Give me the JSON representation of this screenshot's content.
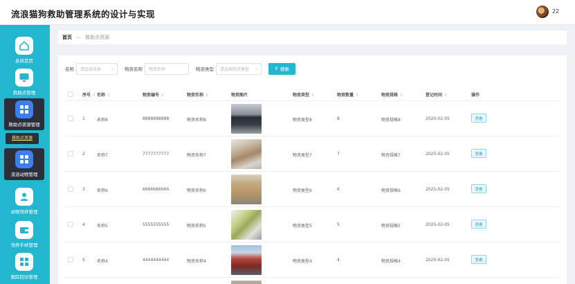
{
  "app": {
    "title": "流浪猫狗救助管理系统的设计与实现"
  },
  "user": {
    "name": "22"
  },
  "sidebar": {
    "items": [
      {
        "label": "系统首页",
        "icon": "home-icon"
      },
      {
        "label": "救助点管理",
        "icon": "monitor-icon"
      },
      {
        "label": "救助点资源管理",
        "icon": "grid-icon",
        "active": true
      },
      {
        "label": "流浪动物管理",
        "icon": "grid-icon",
        "active": true
      },
      {
        "label": "动物领养管理",
        "icon": "person-icon"
      },
      {
        "label": "领养手续管理",
        "icon": "wallet-icon"
      },
      {
        "label": "跟踪回访管理",
        "icon": "grid-icon"
      }
    ],
    "sub_item": "救助点资源"
  },
  "breadcrumb": {
    "home": "首页",
    "separator": "—",
    "current": "救助点资源"
  },
  "search": {
    "name_label": "名称",
    "name_placeholder": "请选择名称",
    "material_name_label": "物资名称",
    "material_name_placeholder": "物资名称",
    "material_type_label": "物资类型",
    "material_type_placeholder": "请选择物资类型",
    "button_label": "搜索"
  },
  "table": {
    "columns": [
      "序号",
      "名称",
      "物资编号",
      "物资名称",
      "物资图片",
      "物资类型",
      "物资数量",
      "物资规格",
      "登记时间",
      "操作"
    ],
    "rows": [
      {
        "index": "1",
        "name": "名称8",
        "code": "8888888888",
        "material": "物资名称8",
        "type": "物资类型8",
        "qty": "8",
        "spec": "物资规格8",
        "date": "2025-02-05",
        "action": "查看"
      },
      {
        "index": "2",
        "name": "名称7",
        "code": "7777777777",
        "material": "物资名称7",
        "type": "物资类型7",
        "qty": "7",
        "spec": "物资规格7",
        "date": "2025-02-05",
        "action": "查看"
      },
      {
        "index": "3",
        "name": "名称6",
        "code": "6666666666",
        "material": "物资名称6",
        "type": "物资类型6",
        "qty": "6",
        "spec": "物资规格6",
        "date": "2025-02-05",
        "action": "查看"
      },
      {
        "index": "4",
        "name": "名称5",
        "code": "5555555555",
        "material": "物资名称5",
        "type": "物资类型5",
        "qty": "5",
        "spec": "物资规格5",
        "date": "2025-02-05",
        "action": "查看"
      },
      {
        "index": "5",
        "name": "名称4",
        "code": "4444444444",
        "material": "物资名称4",
        "type": "物资类型4",
        "qty": "4",
        "spec": "物资规格4",
        "date": "2025-02-05",
        "action": "查看"
      }
    ]
  },
  "colors": {
    "accent": "#23b6cf",
    "sidebar_active": "#2c2f3a",
    "icon_active": "#3b7ff5"
  }
}
